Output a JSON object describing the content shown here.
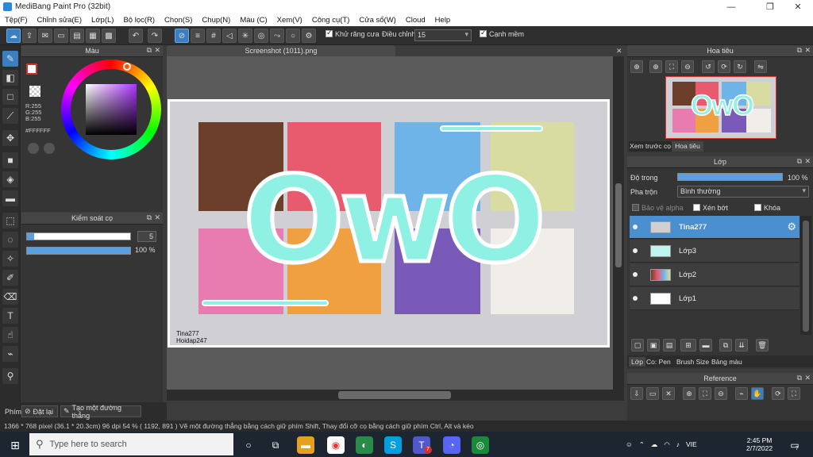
{
  "window": {
    "title": "MediBang Paint Pro (32bit)",
    "min": "—",
    "max": "❐",
    "close": "✕"
  },
  "menu": [
    "Tệp(F)",
    "Chỉnh sửa(E)",
    "Lớp(L)",
    "Bộ lọc(R)",
    "Chọn(S)",
    "Chụp(N)",
    "Màu (C)",
    "Xem(V)",
    "Công cụ(T)",
    "Cửa sổ(W)",
    "Cloud",
    "Help"
  ],
  "toolbar": {
    "antialias_label": "Khử răng cưa",
    "correction_label": "Điều chỉnh",
    "correction_value": "15",
    "sharp_edge_label": "Cạnh mềm"
  },
  "color_panel": {
    "title": "Màu",
    "r": "R:255",
    "g": "G:255",
    "b": "B:255",
    "hex": "#FFFFFF",
    "colors": {
      "fg": "#ffffff",
      "accent": "#d32f2f"
    }
  },
  "brush_control": {
    "title": "Kiểm soát cọ",
    "size_value": "5",
    "size_fraction": 0.07,
    "opacity_value": "100 %",
    "opacity_fraction": 1.0
  },
  "document": {
    "tab_title": "Screenshot (1011).png",
    "watermark_line1": "Tina277",
    "watermark_line2": "Hoidap247",
    "big_text": "OwO"
  },
  "navigator": {
    "title": "Hoa tiêu",
    "tab_preview": "Xem trước cọ",
    "tab_nav": "Hoa tiêu"
  },
  "layer_panel": {
    "title": "Lớp",
    "opacity_label": "Độ trong",
    "opacity_value": "100 %",
    "opacity_fraction": 1.0,
    "blend_label": "Pha trộn",
    "blend_value": "Bình thường",
    "protect_alpha": "Bảo vệ alpha",
    "clipping": "Xén bớt",
    "lock": "Khóa",
    "layers": [
      {
        "name": "Tina277",
        "selected": true
      },
      {
        "name": "Lớp3",
        "selected": false
      },
      {
        "name": "Lớp2",
        "selected": false
      },
      {
        "name": "Lớp1",
        "selected": false
      }
    ],
    "bottom_tabs": [
      "Lớp",
      "Co: Pen",
      "Brush Size",
      "Bảng màu"
    ]
  },
  "reference": {
    "title": "Reference"
  },
  "bottom_left": {
    "tab": "Phím",
    "reset": "Đặt lại",
    "make_line": "Tạo một đường thẳng"
  },
  "status": {
    "text": "1366 * 768 pixel   (36.1 * 20.3cm)   96 dpi   54 %   ( 1192, 891 )   Vẽ một đường thẳng bằng cách giữ phím Shift, Thay đổi cỡ cọ bằng cách giữ phím Ctrl, Alt và kéo"
  },
  "taskbar": {
    "search_placeholder": "Type here to search",
    "lang": "VIE",
    "time": "2:45 PM",
    "date": "2/7/2022",
    "notif_count": "7",
    "teams_badge": "7"
  }
}
